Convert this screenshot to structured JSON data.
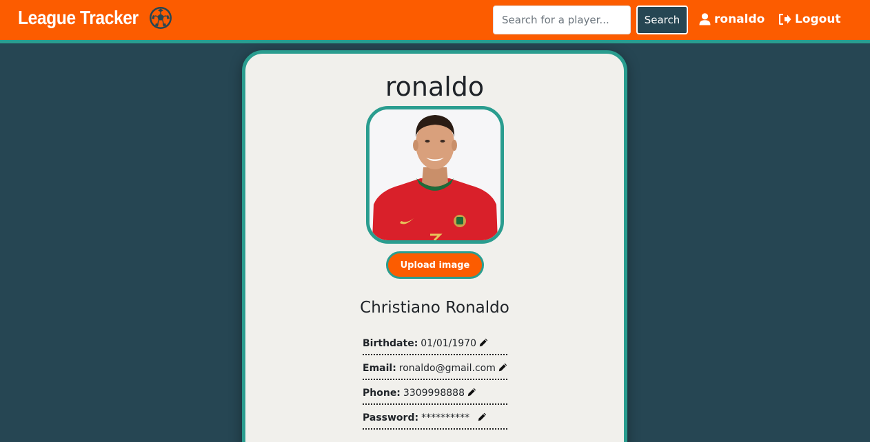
{
  "nav": {
    "brand": "League Tracker",
    "search_placeholder": "Search for a player...",
    "search_label": "Search",
    "user_label": "ronaldo",
    "logout_label": "Logout"
  },
  "profile": {
    "username": "ronaldo",
    "upload_label": "Upload image",
    "full_name": "Christiano Ronaldo",
    "fields": [
      {
        "label": "Birthdate:",
        "value": "01/01/1970"
      },
      {
        "label": "Email:",
        "value": "ronaldo@gmail.com"
      },
      {
        "label": "Phone:",
        "value": "3309998888"
      },
      {
        "label": "Password:",
        "value": "**********"
      }
    ]
  },
  "colors": {
    "accent_orange": "#fc5c00",
    "teal": "#2a9d8f",
    "dark_bg": "#264653",
    "card_bg": "#f1f0ec"
  },
  "icons": [
    "soccer-ball-icon",
    "user-icon",
    "logout-icon",
    "pencil-icon"
  ]
}
